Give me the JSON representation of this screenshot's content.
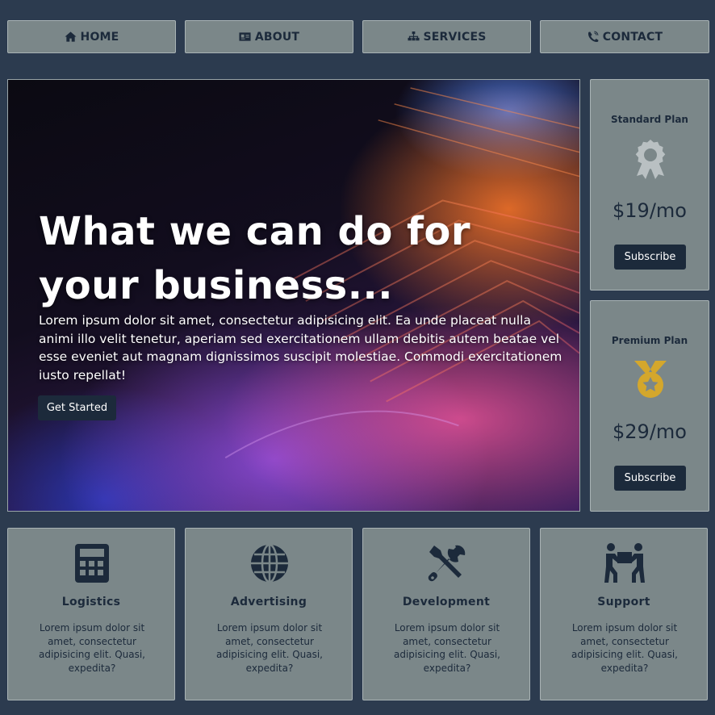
{
  "nav": [
    {
      "label": "HOME",
      "icon": "home-icon"
    },
    {
      "label": "ABOUT",
      "icon": "id-card-icon"
    },
    {
      "label": "SERVICES",
      "icon": "sitemap-icon"
    },
    {
      "label": "CONTACT",
      "icon": "phone-icon"
    }
  ],
  "hero": {
    "title": "What we can do for your business...",
    "text": "Lorem ipsum dolor sit amet, consectetur adipisicing elit. Ea unde placeat nulla animi illo velit tenetur, aperiam sed exercitationem ullam debitis autem beatae vel esse eveniet aut magnam dignissimos suscipit molestiae. Commodi exercitationem iusto repellat!",
    "button": "Get Started"
  },
  "plans": [
    {
      "name": "Standard Plan",
      "price": "$19/mo",
      "button": "Subscribe",
      "icon": "award-ribbon-icon",
      "icon_color": "#b9c0c2"
    },
    {
      "name": "Premium Plan",
      "price": "$29/mo",
      "button": "Subscribe",
      "icon": "gold-medal-icon",
      "icon_color": "#d4a72c"
    }
  ],
  "services": [
    {
      "title": "Logistics",
      "text": "Lorem ipsum dolor sit amet, consectetur adipisicing elit. Quasi, expedita?",
      "icon": "calculator-icon"
    },
    {
      "title": "Advertising",
      "text": "Lorem ipsum dolor sit amet, consectetur adipisicing elit. Quasi, expedita?",
      "icon": "globe-icon"
    },
    {
      "title": "Development",
      "text": "Lorem ipsum dolor sit amet, consectetur adipisicing elit. Quasi, expedita?",
      "icon": "tools-icon"
    },
    {
      "title": "Support",
      "text": "Lorem ipsum dolor sit amet, consectetur adipisicing elit. Quasi, expedita?",
      "icon": "people-carry-icon"
    }
  ],
  "colors": {
    "background": "#2c3b4f",
    "panel": "#7b8789",
    "dark": "#1c2a3b",
    "gold": "#d4a72c"
  }
}
